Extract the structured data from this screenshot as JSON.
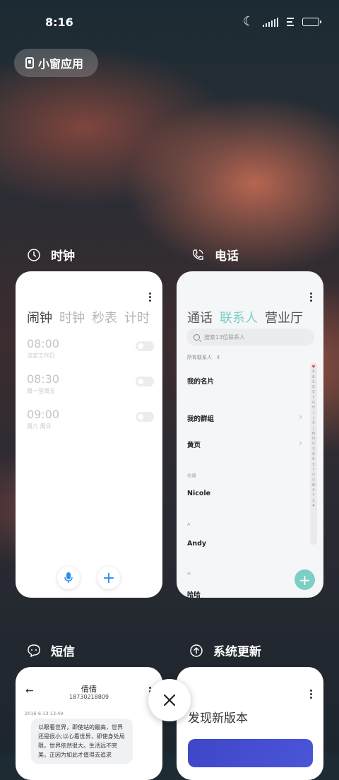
{
  "status": {
    "time": "8:16"
  },
  "mini_window": {
    "label": "小窗应用"
  },
  "clock_app": {
    "name": "时钟",
    "tabs": [
      "闹钟",
      "时钟",
      "秒表",
      "计时"
    ],
    "alarms": [
      {
        "time": "08:00",
        "repeat": "法定工作日"
      },
      {
        "time": "08:30",
        "repeat": "周一至周五"
      },
      {
        "time": "09:00",
        "repeat": "周六 周日"
      }
    ]
  },
  "phone_app": {
    "name": "电话",
    "tabs": [
      "通话",
      "联系人",
      "营业厅"
    ],
    "search_placeholder": "搜索13位联系人",
    "filter": "所有联系人",
    "rows": {
      "my_card": "我的名片",
      "my_groups": "我的群组",
      "yellow_pages": "黄页",
      "favorites": "收藏",
      "nicole": "Nicole",
      "a": "A",
      "andy": "Andy",
      "h": "H",
      "haha": "哈哈"
    },
    "alphabet": [
      "♥",
      "A",
      "B",
      "C",
      "D",
      "E",
      "F",
      "G",
      "H",
      "I",
      "J",
      "K",
      "L",
      "M",
      "N",
      "O",
      "P",
      "Q",
      "R",
      "S",
      "T",
      "U",
      "V",
      "W",
      "X",
      "Y",
      "Z",
      "#"
    ]
  },
  "sms_app": {
    "name": "短信",
    "contact": "倩倩",
    "number": "18730218809",
    "date": "2016-6-13 13:49",
    "message": "以眼看世界，即使站的最高，世界还是很小;以心看世界，即使身处局限，世界依然很大。生活远不完美，正因为如此才值得去追求"
  },
  "update_app": {
    "name": "系统更新",
    "title": "发现新版本"
  }
}
